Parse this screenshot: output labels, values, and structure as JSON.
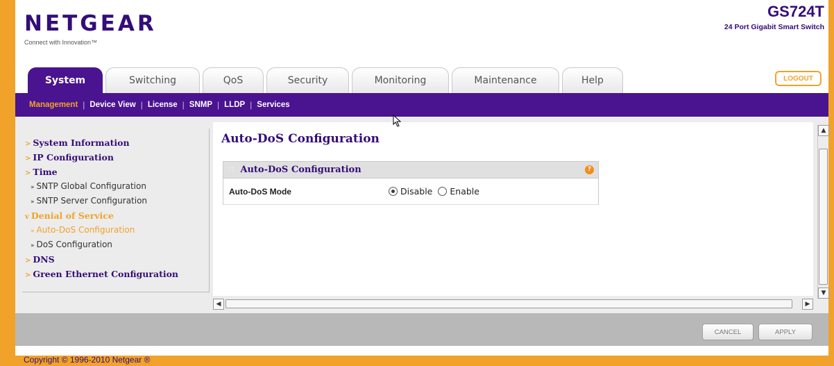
{
  "brand": {
    "logo": "NETGEAR",
    "tagline": "Connect with Innovation™",
    "model": "GS724T",
    "model_desc": "24 Port Gigabit Smart Switch"
  },
  "colors": {
    "brand_purple": "#4a1390",
    "accent_orange": "#f1a22a"
  },
  "tabs": [
    {
      "label": "System",
      "active": true
    },
    {
      "label": "Switching"
    },
    {
      "label": "QoS"
    },
    {
      "label": "Security"
    },
    {
      "label": "Monitoring"
    },
    {
      "label": "Maintenance"
    },
    {
      "label": "Help"
    }
  ],
  "logout_label": "LOGOUT",
  "subnav": [
    {
      "label": "Management",
      "active": true
    },
    {
      "label": "Device View"
    },
    {
      "label": "License"
    },
    {
      "label": "SNMP"
    },
    {
      "label": "LLDP"
    },
    {
      "label": "Services"
    }
  ],
  "sidebar": {
    "items": [
      {
        "label": "System Information"
      },
      {
        "label": "IP Configuration"
      },
      {
        "label": "Time"
      },
      {
        "label": "SNTP Global Configuration",
        "sub": true
      },
      {
        "label": "SNTP Server Configuration",
        "sub": true
      },
      {
        "label": "Denial of Service",
        "open": true
      },
      {
        "label": "Auto-DoS Configuration",
        "sub": true,
        "active": true
      },
      {
        "label": "DoS Configuration",
        "sub": true
      },
      {
        "label": "DNS"
      },
      {
        "label": "Green Ethernet Configuration"
      }
    ]
  },
  "main": {
    "title": "Auto-DoS Configuration",
    "panel_title": "Auto-DoS Configuration",
    "help_icon": "?",
    "field_label": "Auto-DoS Mode",
    "options": [
      "Disable",
      "Enable"
    ],
    "selected": "Disable"
  },
  "footer": {
    "cancel": "CANCEL",
    "apply": "APPLY",
    "copyright": "Copyright © 1996-2010 Netgear ®"
  }
}
